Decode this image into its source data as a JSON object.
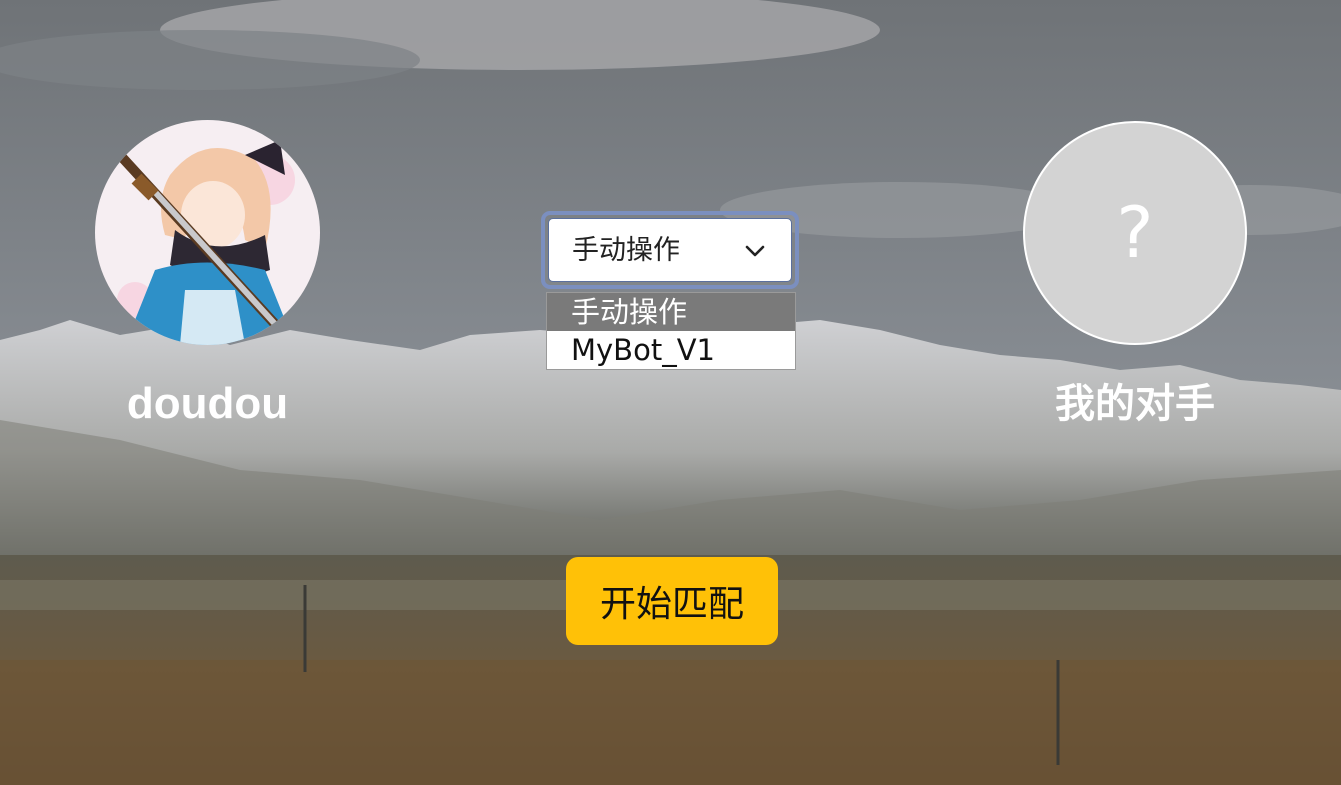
{
  "player": {
    "name": "doudou",
    "avatar_icon": "anime-character-avatar"
  },
  "opponent": {
    "name": "我的对手",
    "avatar_placeholder": "?"
  },
  "bot_select": {
    "selected": "手动操作",
    "options": [
      "手动操作",
      "MyBot_V1"
    ]
  },
  "match_button": {
    "label": "开始匹配"
  },
  "colors": {
    "button_accent": "#ffc107",
    "select_focus_ring": "#7b8fbf",
    "option_highlight": "#7a7a7a",
    "opponent_avatar_bg": "#d3d3d3"
  }
}
